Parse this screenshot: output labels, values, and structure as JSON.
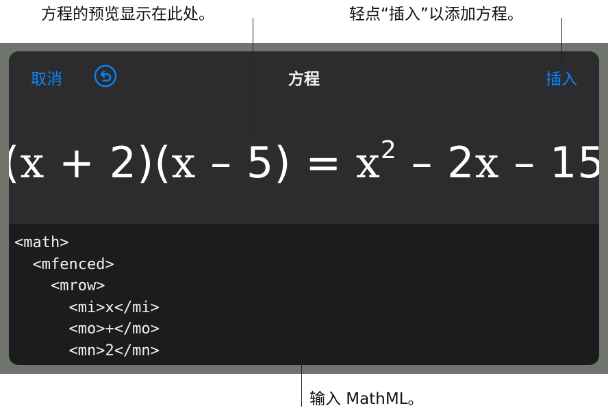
{
  "callouts": {
    "preview": "方程的预览显示在此处。",
    "insert": "轻点“插入”以添加方程。",
    "mathml": "输入 MathML。"
  },
  "toolbar": {
    "cancel_label": "取消",
    "undo_icon": "undo-icon",
    "title": "方程",
    "insert_label": "插入"
  },
  "equation": {
    "open1": "(",
    "v1": "x",
    "op1": " + 2)(",
    "v2": "x",
    "op2": " – 5) = ",
    "v3": "x",
    "exp": "2",
    "op3": " – 2",
    "v4": "x",
    "op4": " – 15"
  },
  "editor": {
    "lines": [
      "<math>",
      "  <mfenced>",
      "    <mrow>",
      "      <mi>x</mi>",
      "      <mo>+</mo>",
      "      <mn>2</mn>"
    ]
  },
  "colors": {
    "accent": "#0a84ff",
    "sheet_bg": "#2c2c2e",
    "editor_bg": "#1c1c1e",
    "frame": "#6f756c"
  }
}
